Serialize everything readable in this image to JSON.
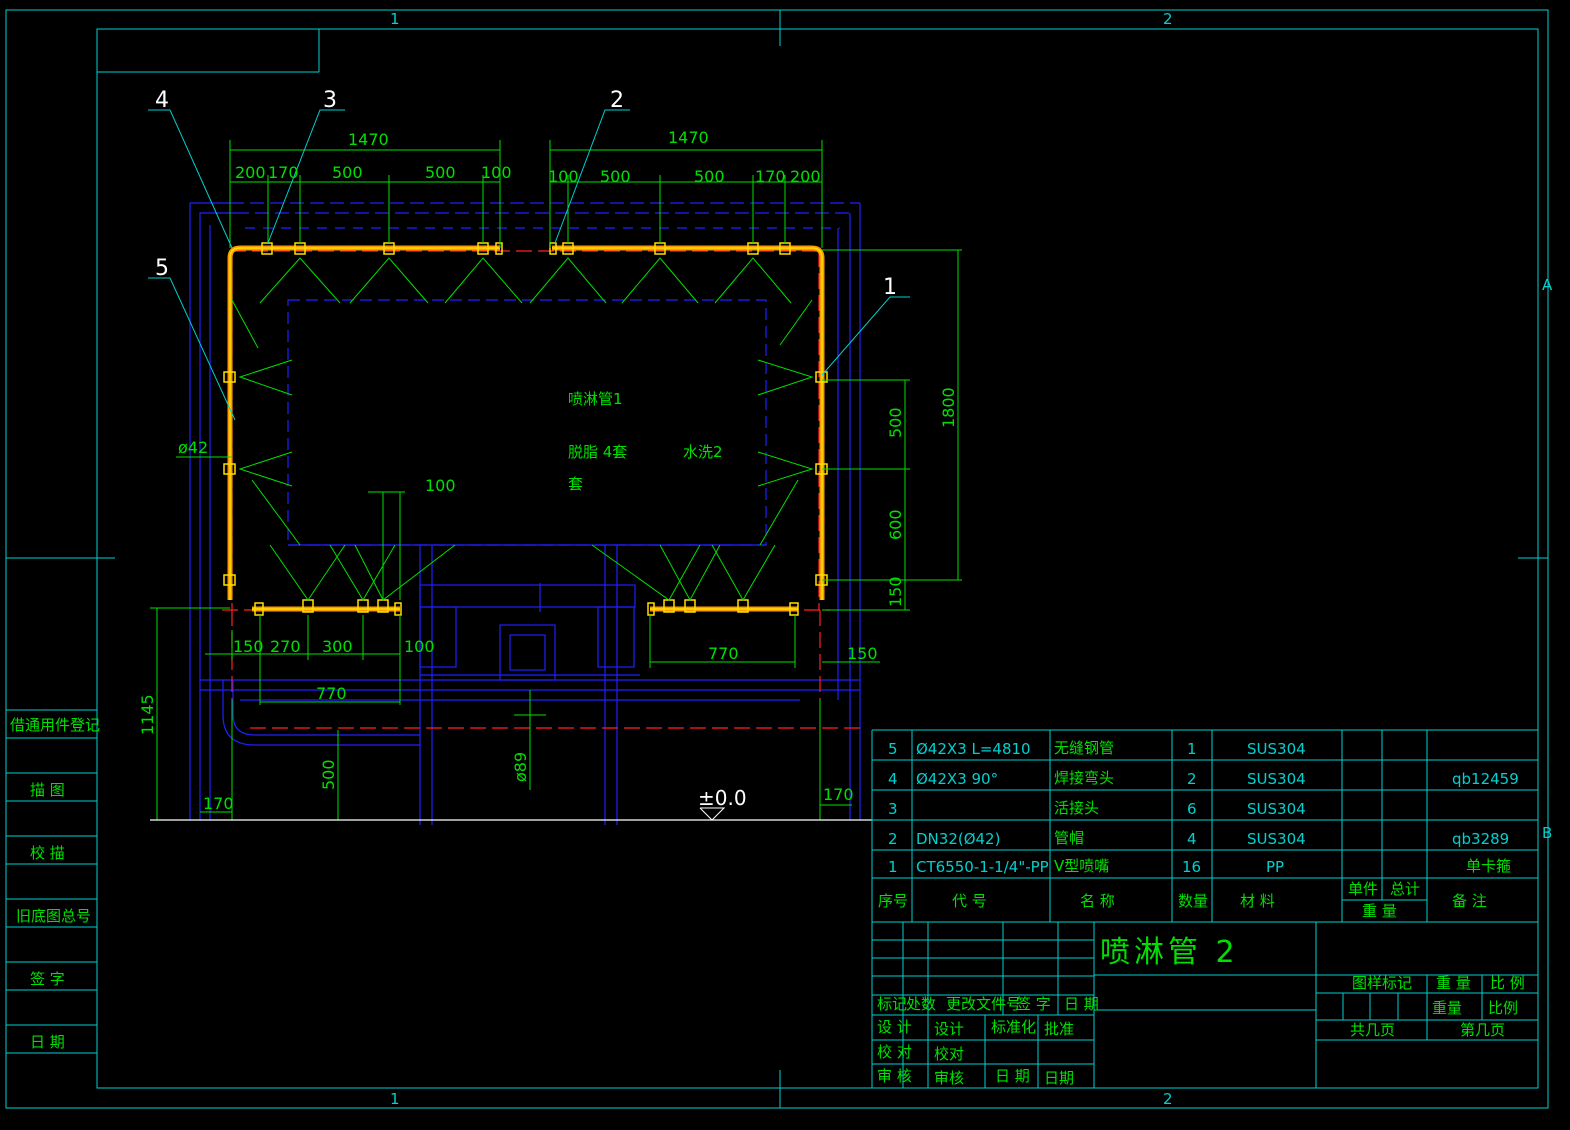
{
  "frame": {
    "zones_top": [
      "1",
      "2"
    ],
    "zones_bottom": [
      "1",
      "2"
    ],
    "zones_right": [
      "A",
      "B"
    ]
  },
  "left_strip": [
    "借通用件登记",
    "描 图",
    "校 描",
    "旧底图总号",
    "签 字",
    "日 期"
  ],
  "balloons": [
    "4",
    "3",
    "2",
    "5",
    "1"
  ],
  "labels": {
    "pipe_name": "喷淋管1",
    "process_a": "脱脂 4套",
    "process_a_cont": "套",
    "process_b": "水洗2",
    "elevation": "±0.0"
  },
  "dimensions": {
    "top_left_total": "1470",
    "top_right_total": "1470",
    "top_left_segments": [
      "200",
      "170",
      "500",
      "500",
      "100"
    ],
    "top_right_segments": [
      "100",
      "500",
      "500",
      "170",
      "200"
    ],
    "right_total": "1800",
    "right_segments": [
      "500",
      "600",
      "150"
    ],
    "pipe_dia": "ø42",
    "mid_100": "100",
    "bottom_left_segments": [
      "150",
      "270",
      "300",
      "100"
    ],
    "bottom_left_770": "770",
    "bottom_right_770": "770",
    "bottom_right_150": "150",
    "left_height": "1145",
    "height_500": "500",
    "dia_89": "ø89",
    "left_170": "170",
    "right_170": "170"
  },
  "bom": {
    "rows": [
      {
        "no": "5",
        "code": "Ø42X3 L=4810",
        "name": "无缝钢管",
        "qty": "1",
        "material": "SUS304",
        "remark": ""
      },
      {
        "no": "4",
        "code": "Ø42X3 90°",
        "name": "焊接弯头",
        "qty": "2",
        "material": "SUS304",
        "remark": "qb12459"
      },
      {
        "no": "3",
        "code": "",
        "name": "活接头",
        "qty": "6",
        "material": "SUS304",
        "remark": ""
      },
      {
        "no": "2",
        "code": "DN32(Ø42)",
        "name": "管帽",
        "qty": "4",
        "material": "SUS304",
        "remark": "qb3289"
      },
      {
        "no": "1",
        "code": "CT6550-1-1/4\"-PP",
        "name": "V型喷嘴",
        "qty": "16",
        "material": "PP",
        "remark": "单卡箍"
      }
    ],
    "header": {
      "no": "序号",
      "code": "代 号",
      "name": "名 称",
      "qty": "数量",
      "material": "材 料",
      "unit": "单件",
      "total": "总计",
      "weight": "重 量",
      "remark": "备 注"
    }
  },
  "title_block": {
    "title": "喷淋管 2",
    "stage_mark": "图样标记",
    "weight_h": "重 量",
    "scale_h": "比 例",
    "weight_lbl": "重量",
    "scale_lbl": "比例",
    "sheets": "共几页",
    "sheet_no": "第几页",
    "rev_headers": [
      "标记",
      "处数",
      "更改文件号",
      "签 字",
      "日 期"
    ],
    "roles": [
      "设 计",
      "校 对",
      "审 核"
    ],
    "roles_big": [
      "设计",
      "校对",
      "审核"
    ],
    "std": "标准化",
    "approve": "批准",
    "date_lbl": "日 期",
    "date_big": "日期"
  }
}
